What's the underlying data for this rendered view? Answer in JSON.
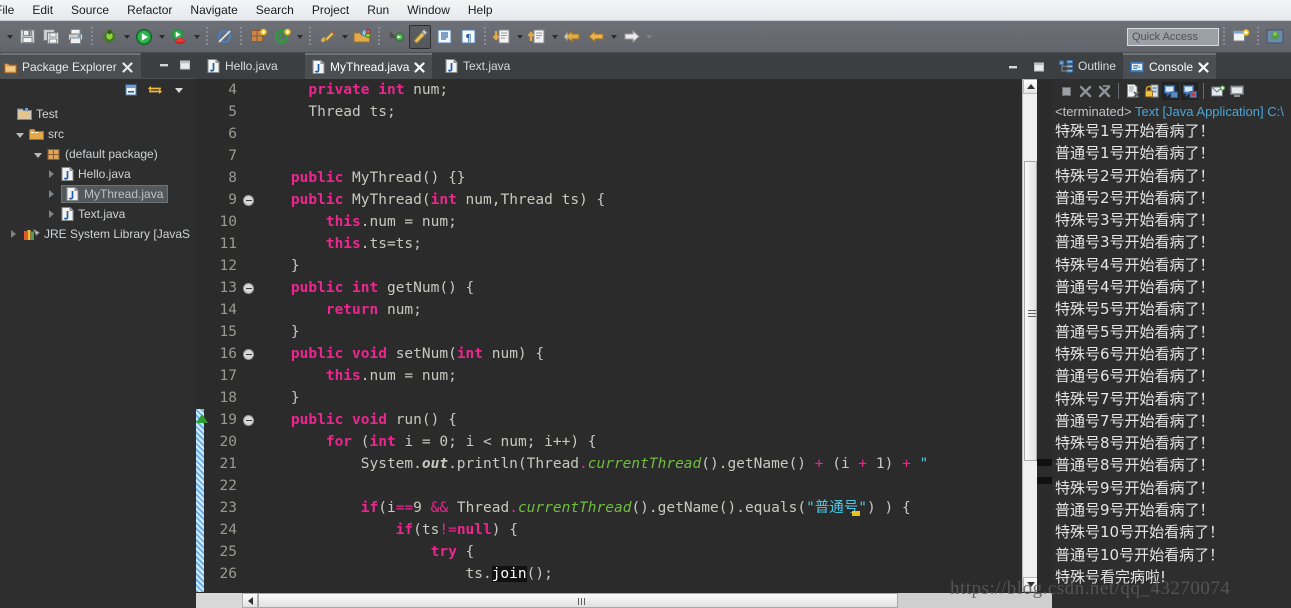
{
  "menu": {
    "items": [
      "File",
      "Edit",
      "Source",
      "Refactor",
      "Navigate",
      "Search",
      "Project",
      "Run",
      "Window",
      "Help"
    ]
  },
  "toolbar": {
    "quick_access_placeholder": "Quick Access",
    "icons": [
      "save-icon",
      "save-all-icon",
      "print-icon",
      "debug-icon",
      "run-icon",
      "external-tools-icon",
      "skip-breakpoints-icon",
      "new-java-package-icon",
      "new-java-class-icon",
      "search-icon",
      "open-type-icon",
      "next-annotation-icon",
      "toggle-block-selection-icon",
      "show-whitespace-icon",
      "previous-edit-icon",
      "next-edit-icon",
      "back-icon",
      "forward-icon"
    ]
  },
  "package_explorer": {
    "title": "Package Explorer",
    "close_icon": "close-icon",
    "minimize_icon": "minimize-icon",
    "maximize_icon": "maximize-icon",
    "view_buttons": [
      "collapse-all-icon",
      "link-with-editor-icon",
      "view-menu-icon"
    ],
    "tree": [
      {
        "label": "Test",
        "indent": 0,
        "icon": "java-project-icon",
        "twist": "open",
        "selected": false
      },
      {
        "label": "src",
        "indent": 1,
        "icon": "source-folder-icon",
        "twist": "open",
        "selected": false
      },
      {
        "label": "(default package)",
        "indent": 2,
        "icon": "package-icon",
        "twist": "open",
        "selected": false
      },
      {
        "label": "Hello.java",
        "indent": 3,
        "icon": "java-file-icon",
        "twist": "closed",
        "selected": false
      },
      {
        "label": "MyThread.java",
        "indent": 3,
        "icon": "java-file-icon",
        "twist": "closed",
        "selected": true
      },
      {
        "label": "Text.java",
        "indent": 3,
        "icon": "java-file-icon",
        "twist": "closed",
        "selected": false
      },
      {
        "label": "JRE System Library [JavaS",
        "indent": 1,
        "icon": "library-icon",
        "twist": "closed",
        "selected": false
      }
    ]
  },
  "editor": {
    "tabs": [
      {
        "label": "Hello.java",
        "active": false,
        "closable": false
      },
      {
        "label": "MyThread.java",
        "active": true,
        "closable": true
      },
      {
        "label": "Text.java",
        "active": false,
        "closable": false
      }
    ],
    "window_buttons": [
      "minimize-icon",
      "maximize-icon"
    ],
    "first_line_number": 4,
    "change_bar_lines": [
      19,
      20,
      21,
      22,
      23,
      24,
      25,
      26
    ],
    "lines": [
      {
        "n": 4,
        "fold": false,
        "override": false,
        "tokens": [
          {
            "t": "      ",
            "c": "txt"
          },
          {
            "t": "private",
            "c": "kw"
          },
          {
            "t": " ",
            "c": "txt"
          },
          {
            "t": "int",
            "c": "kw"
          },
          {
            "t": " num;",
            "c": "txt"
          }
        ]
      },
      {
        "n": 5,
        "fold": false,
        "override": false,
        "tokens": [
          {
            "t": "      Thread ts;",
            "c": "txt"
          }
        ]
      },
      {
        "n": 6,
        "fold": false,
        "override": false,
        "tokens": [
          {
            "t": "",
            "c": "txt"
          }
        ]
      },
      {
        "n": 7,
        "fold": false,
        "override": false,
        "tokens": [
          {
            "t": "",
            "c": "txt"
          }
        ]
      },
      {
        "n": 8,
        "fold": false,
        "override": false,
        "tokens": [
          {
            "t": "    ",
            "c": "txt"
          },
          {
            "t": "public",
            "c": "kw"
          },
          {
            "t": " MyThread() {}",
            "c": "txt"
          }
        ]
      },
      {
        "n": 9,
        "fold": true,
        "override": false,
        "tokens": [
          {
            "t": "    ",
            "c": "txt"
          },
          {
            "t": "public",
            "c": "kw"
          },
          {
            "t": " MyThread(",
            "c": "txt"
          },
          {
            "t": "int",
            "c": "kw"
          },
          {
            "t": " num,Thread ts) {",
            "c": "txt"
          }
        ]
      },
      {
        "n": 10,
        "fold": false,
        "override": false,
        "tokens": [
          {
            "t": "        ",
            "c": "txt"
          },
          {
            "t": "this",
            "c": "kw"
          },
          {
            "t": ".num ",
            "c": "txt"
          },
          {
            "t": "=",
            "c": "txt"
          },
          {
            "t": " num;",
            "c": "txt"
          }
        ]
      },
      {
        "n": 11,
        "fold": false,
        "override": false,
        "tokens": [
          {
            "t": "        ",
            "c": "txt"
          },
          {
            "t": "this",
            "c": "kw"
          },
          {
            "t": ".ts=ts;",
            "c": "txt"
          }
        ]
      },
      {
        "n": 12,
        "fold": false,
        "override": false,
        "tokens": [
          {
            "t": "    }",
            "c": "txt"
          }
        ]
      },
      {
        "n": 13,
        "fold": true,
        "override": false,
        "tokens": [
          {
            "t": "    ",
            "c": "txt"
          },
          {
            "t": "public",
            "c": "kw"
          },
          {
            "t": " ",
            "c": "txt"
          },
          {
            "t": "int",
            "c": "kw"
          },
          {
            "t": " getNum() {",
            "c": "txt"
          }
        ]
      },
      {
        "n": 14,
        "fold": false,
        "override": false,
        "tokens": [
          {
            "t": "        ",
            "c": "txt"
          },
          {
            "t": "return",
            "c": "kw"
          },
          {
            "t": " num;",
            "c": "txt"
          }
        ]
      },
      {
        "n": 15,
        "fold": false,
        "override": false,
        "tokens": [
          {
            "t": "    }",
            "c": "txt"
          }
        ]
      },
      {
        "n": 16,
        "fold": true,
        "override": false,
        "tokens": [
          {
            "t": "    ",
            "c": "txt"
          },
          {
            "t": "public",
            "c": "kw"
          },
          {
            "t": " ",
            "c": "txt"
          },
          {
            "t": "void",
            "c": "kw"
          },
          {
            "t": " setNum(",
            "c": "txt"
          },
          {
            "t": "int",
            "c": "kw"
          },
          {
            "t": " num) {",
            "c": "txt"
          }
        ]
      },
      {
        "n": 17,
        "fold": false,
        "override": false,
        "tokens": [
          {
            "t": "        ",
            "c": "txt"
          },
          {
            "t": "this",
            "c": "kw"
          },
          {
            "t": ".num ",
            "c": "txt"
          },
          {
            "t": "=",
            "c": "txt"
          },
          {
            "t": " num;",
            "c": "txt"
          }
        ]
      },
      {
        "n": 18,
        "fold": false,
        "override": false,
        "tokens": [
          {
            "t": "    }",
            "c": "txt"
          }
        ]
      },
      {
        "n": 19,
        "fold": true,
        "override": true,
        "tokens": [
          {
            "t": "    ",
            "c": "txt"
          },
          {
            "t": "public",
            "c": "kw"
          },
          {
            "t": " ",
            "c": "txt"
          },
          {
            "t": "void",
            "c": "kw"
          },
          {
            "t": " run() {",
            "c": "txt"
          }
        ]
      },
      {
        "n": 20,
        "fold": false,
        "override": false,
        "tokens": [
          {
            "t": "        ",
            "c": "txt"
          },
          {
            "t": "for",
            "c": "kw"
          },
          {
            "t": " (",
            "c": "txt"
          },
          {
            "t": "int",
            "c": "kw"
          },
          {
            "t": " i ",
            "c": "txt"
          },
          {
            "t": "=",
            "c": "txt"
          },
          {
            "t": " 0; i ",
            "c": "txt"
          },
          {
            "t": "<",
            "c": "txt"
          },
          {
            "t": " num; i++) {",
            "c": "txt"
          }
        ]
      },
      {
        "n": 21,
        "fold": false,
        "override": false,
        "tokens": [
          {
            "t": "            System.",
            "c": "txt"
          },
          {
            "t": "out",
            "c": "statb"
          },
          {
            "t": ".println(Thread",
            "c": "txt"
          },
          {
            "t": ".",
            "c": "op"
          },
          {
            "t": "currentThread",
            "c": "stat"
          },
          {
            "t": "().getName() ",
            "c": "txt"
          },
          {
            "t": "+",
            "c": "op"
          },
          {
            "t": " (i ",
            "c": "txt"
          },
          {
            "t": "+",
            "c": "op"
          },
          {
            "t": " 1) ",
            "c": "txt"
          },
          {
            "t": "+",
            "c": "op"
          },
          {
            "t": " \"",
            "c": "str"
          }
        ]
      },
      {
        "n": 22,
        "fold": false,
        "override": false,
        "tokens": [
          {
            "t": "",
            "c": "txt"
          }
        ]
      },
      {
        "n": 23,
        "fold": false,
        "override": false,
        "tokens": [
          {
            "t": "            ",
            "c": "txt"
          },
          {
            "t": "if",
            "c": "kw"
          },
          {
            "t": "(i",
            "c": "txt"
          },
          {
            "t": "==",
            "c": "op"
          },
          {
            "t": "9 ",
            "c": "txt"
          },
          {
            "t": "&&",
            "c": "op"
          },
          {
            "t": " Thread",
            "c": "txt"
          },
          {
            "t": ".",
            "c": "op"
          },
          {
            "t": "currentThread",
            "c": "stat"
          },
          {
            "t": "().getName().equals(",
            "c": "txt"
          },
          {
            "t": "\"普通号\"",
            "c": "str"
          },
          {
            "t": ") ) {",
            "c": "txt"
          }
        ]
      },
      {
        "n": 24,
        "fold": false,
        "override": false,
        "tokens": [
          {
            "t": "                ",
            "c": "txt"
          },
          {
            "t": "if",
            "c": "kw"
          },
          {
            "t": "(ts",
            "c": "txt"
          },
          {
            "t": "!=",
            "c": "op"
          },
          {
            "t": "null",
            "c": "kw"
          },
          {
            "t": ") {",
            "c": "txt"
          }
        ]
      },
      {
        "n": 25,
        "fold": false,
        "override": false,
        "tokens": [
          {
            "t": "                    ",
            "c": "txt"
          },
          {
            "t": "try",
            "c": "kw"
          },
          {
            "t": " {",
            "c": "txt"
          }
        ]
      },
      {
        "n": 26,
        "fold": false,
        "override": false,
        "tokens": [
          {
            "t": "                        ts.",
            "c": "txt"
          },
          {
            "t": "join",
            "c": "sel-word"
          },
          {
            "t": "();",
            "c": "txt"
          }
        ]
      }
    ]
  },
  "console": {
    "tabs": [
      {
        "label": "Outline",
        "active": false,
        "icon": "outline-icon",
        "closable": false
      },
      {
        "label": "Console",
        "active": true,
        "icon": "console-icon",
        "closable": true
      }
    ],
    "toolbar_icons": [
      "terminate-icon",
      "remove-launch-icon",
      "remove-all-terminated-icon",
      "clear-console-icon",
      "scroll-lock-icon",
      "pin-console-icon",
      "display-selected-console-icon",
      "open-console-icon",
      "new-console-view-icon"
    ],
    "header": {
      "terminated": "<terminated>",
      "text": " Text [Java Application] C:\\"
    },
    "output": [
      "特殊号1号开始看病了！",
      "普通号1号开始看病了！",
      "特殊号2号开始看病了！",
      "普通号2号开始看病了！",
      "特殊号3号开始看病了！",
      "普通号3号开始看病了！",
      "特殊号4号开始看病了！",
      "普通号4号开始看病了！",
      "特殊号5号开始看病了！",
      "普通号5号开始看病了！",
      "特殊号6号开始看病了！",
      "普通号6号开始看病了！",
      "特殊号7号开始看病了！",
      "普通号7号开始看病了！",
      "特殊号8号开始看病了！",
      "普通号8号开始看病了！",
      "特殊号9号开始看病了！",
      "普通号9号开始看病了！",
      "特殊号10号开始看病了！",
      "普通号10号开始看病了！",
      "特殊号看完病啦!"
    ]
  },
  "watermark": {
    "text": "https://blog.csdn.net/qq_43270074"
  },
  "colors": {
    "keyword": "#ec268f",
    "static_method": "#6fbf3f",
    "string": "#4ec9e6",
    "editor_bg": "#2b2b2b",
    "panel_bg": "#2e2e2e",
    "tab_active_bg": "#4b4f52",
    "console_header": "#4aa6d8"
  }
}
